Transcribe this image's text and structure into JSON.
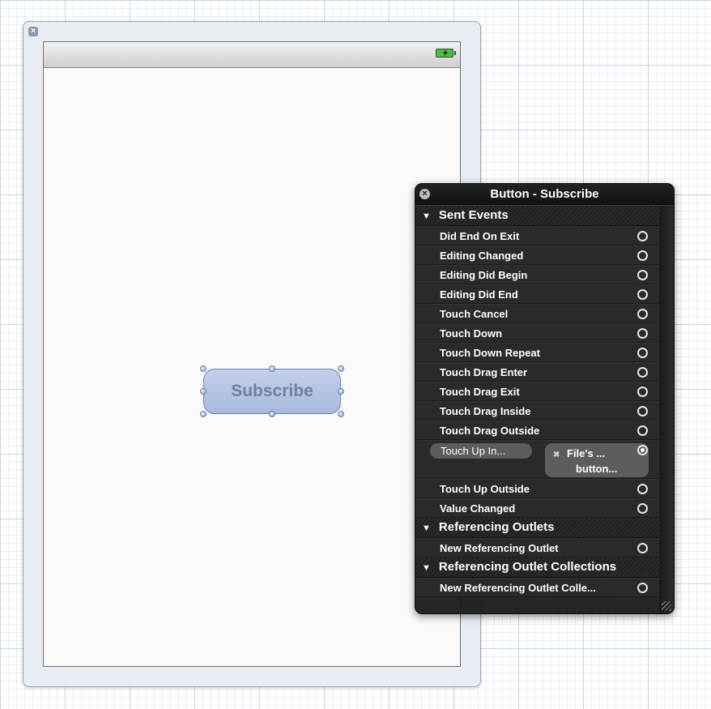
{
  "view": {
    "button_label": "Subscribe"
  },
  "hud": {
    "title": "Button - Subscribe",
    "sections": {
      "sent_events": "Sent Events",
      "referencing_outlets": "Referencing Outlets",
      "referencing_outlet_collections": "Referencing Outlet Collections"
    },
    "events_before": [
      "Did End On Exit",
      "Editing Changed",
      "Editing Did Begin",
      "Editing Did End",
      "Touch Cancel",
      "Touch Down",
      "Touch Down Repeat",
      "Touch Drag Enter",
      "Touch Drag Exit",
      "Touch Drag Inside",
      "Touch Drag Outside"
    ],
    "connected_event": {
      "event": "Touch Up In...",
      "target_line1": "File's ...",
      "target_line2": "button..."
    },
    "events_after": [
      "Touch Up Outside",
      "Value Changed"
    ],
    "outlet_row": "New Referencing Outlet",
    "collection_row": "New Referencing Outlet Colle..."
  }
}
